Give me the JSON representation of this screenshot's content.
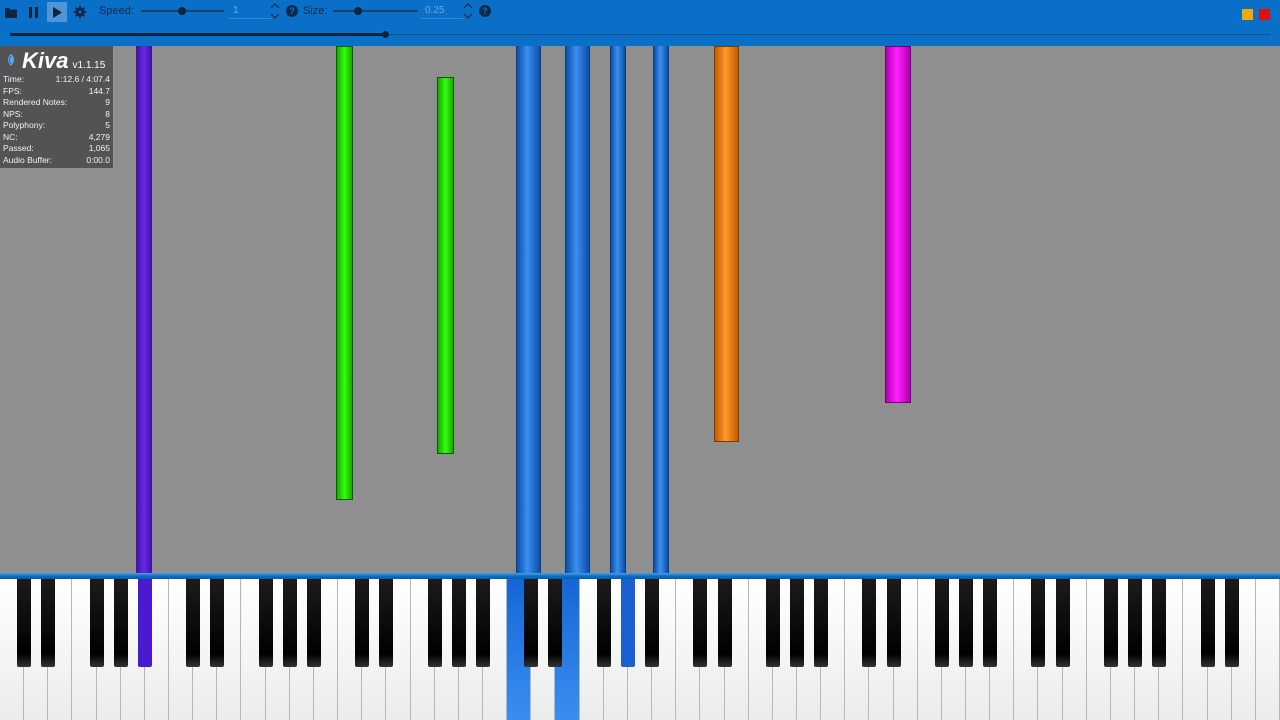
{
  "app": {
    "name": "Kiva",
    "version": "v1.1.15"
  },
  "toolbar": {
    "speed_label": "Speed:",
    "speed_value": "1",
    "speed_slider_fraction": 0.49,
    "size_label": "Size:",
    "size_value": "0.25",
    "size_slider_fraction": 0.29,
    "seek_fraction": 0.298,
    "icons": [
      "folder-icon",
      "pause-icon",
      "play-icon",
      "gear-icon",
      "help-icon"
    ]
  },
  "stats": [
    {
      "label": "Time:",
      "value": "1:12.6 / 4:07.4"
    },
    {
      "label": "FPS:",
      "value": "144.7"
    },
    {
      "label": "Rendered Notes:",
      "value": "9"
    },
    {
      "label": "NPS:",
      "value": "8"
    },
    {
      "label": "Polyphony:",
      "value": "5"
    },
    {
      "label": "NC:",
      "value": "4,279"
    },
    {
      "label": "Passed:",
      "value": "1,065"
    },
    {
      "label": "Audio Buffer:",
      "value": "0:00.0"
    }
  ],
  "colors": {
    "toolbar": "#0a6fc6",
    "background": "#8f8f8f",
    "purple_note": "#5a1fd0",
    "green_note": "#22e000",
    "blue_note": "#1466d6",
    "orange_note": "#f07a12",
    "magenta_note": "#e010e0",
    "minimize": "#f2a900",
    "close": "#e01010"
  }
}
